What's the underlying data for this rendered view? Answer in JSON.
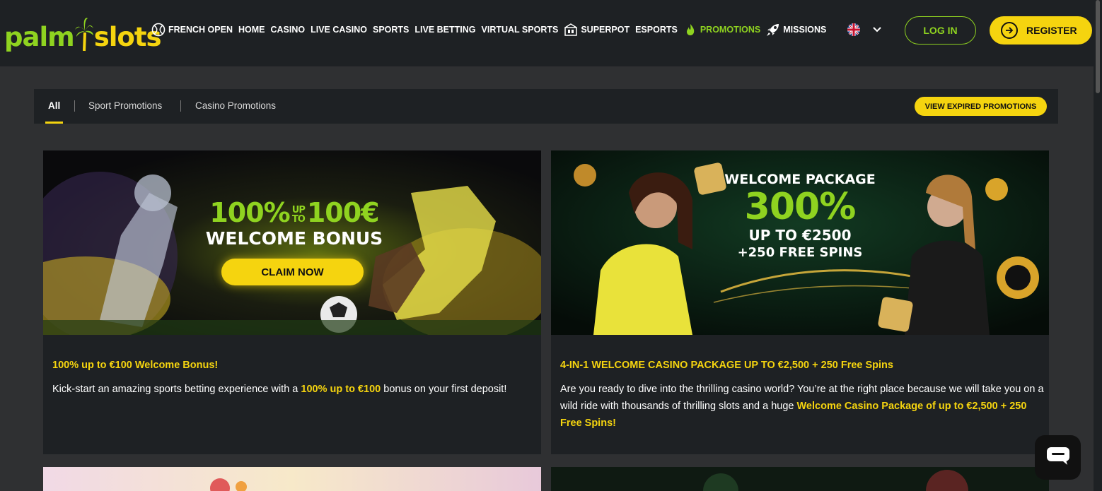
{
  "brand": {
    "part1": "palm",
    "part2": "slots"
  },
  "nav": [
    {
      "label": "FRENCH OPEN",
      "icon": "tennis-ball-icon"
    },
    {
      "label": "HOME"
    },
    {
      "label": "CASINO"
    },
    {
      "label": "LIVE CASINO"
    },
    {
      "label": "SPORTS"
    },
    {
      "label": "LIVE BETTING"
    },
    {
      "label": "VIRTUAL SPORTS"
    },
    {
      "label": "SUPERPOT",
      "icon": "superpot-icon"
    },
    {
      "label": "ESPORTS"
    },
    {
      "label": "PROMOTIONS",
      "icon": "flame-icon",
      "active": true
    },
    {
      "label": "MISSIONS",
      "icon": "rocket-icon"
    }
  ],
  "header": {
    "login_label": "LOG IN",
    "register_label": "REGISTER",
    "language": "flag-uk-icon"
  },
  "tabs": [
    {
      "label": "All",
      "active": true
    },
    {
      "label": "Sport Promotions"
    },
    {
      "label": "Casino Promotions"
    }
  ],
  "view_expired_label": "VIEW EXPIRED PROMOTIONS",
  "cards": [
    {
      "banner": {
        "line1a": "100%",
        "line1b_top": "UP",
        "line1b_bot": "TO",
        "line1c": "100€",
        "line2": "WELCOME BONUS",
        "cta": "CLAIM NOW"
      },
      "title": "100% up to €100 Welcome Bonus!",
      "desc_pre": "Kick-start an amazing sports betting experience with a ",
      "desc_hl": "100% up to €100",
      "desc_post": " bonus on your first deposit!"
    },
    {
      "banner": {
        "line1": "WELCOME PACKAGE",
        "line2": "300%",
        "line3": "UP TO €2500",
        "line4": "+250 FREE SPINS"
      },
      "title": "4-IN-1 WELCOME CASINO PACKAGE UP TO €2,500 + 250 Free Spins",
      "desc_pre": "Are you ready to dive into the thrilling casino world? You’re at the right place because we will take you on a wild ride with thousands of thrilling slots and a huge ",
      "desc_hl": "Welcome Casino Package of up to €2,500 + 250 Free Spins!",
      "desc_post": ""
    }
  ],
  "colors": {
    "accent_green": "#8fd320",
    "accent_yellow": "#f5d40f",
    "bg": "#2f3032",
    "panel": "#1e2124"
  }
}
